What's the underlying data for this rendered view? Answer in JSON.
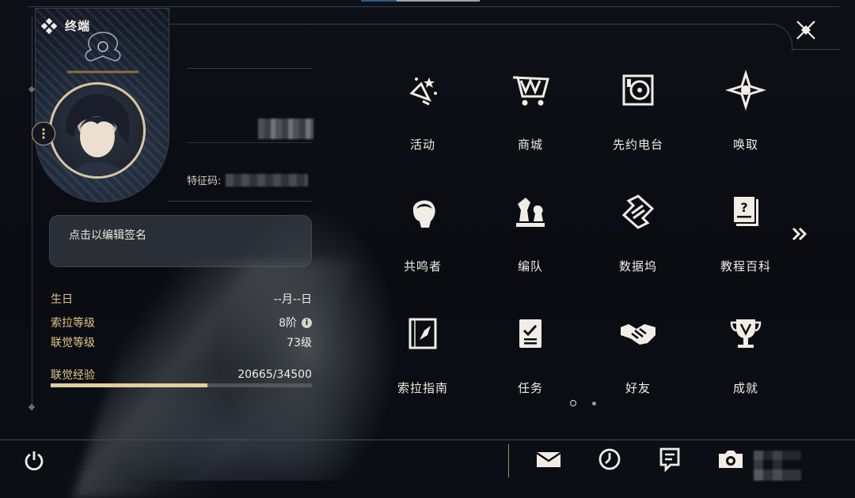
{
  "window": {
    "title": "终端"
  },
  "profile": {
    "uid_label": "特征码:",
    "signature_placeholder": "点击以编辑签名"
  },
  "stats": [
    {
      "label": "生日",
      "value": "--月--日"
    },
    {
      "label": "索拉等级",
      "value": "8阶",
      "info": "i"
    },
    {
      "label": "联觉等级",
      "value": "73级"
    },
    {
      "label": "联觉经验",
      "value": "20665/34500",
      "progress": 0.599
    }
  ],
  "menu": [
    {
      "label": "活动",
      "icon": "activity-icon"
    },
    {
      "label": "商城",
      "icon": "shop-cart-icon"
    },
    {
      "label": "先约电台",
      "icon": "radio-icon"
    },
    {
      "label": "唤取",
      "icon": "convene-star-icon"
    },
    {
      "label": "共鸣者",
      "icon": "resonator-icon"
    },
    {
      "label": "编队",
      "icon": "team-chess-icon"
    },
    {
      "label": "数据坞",
      "icon": "data-bank-icon"
    },
    {
      "label": "教程百科",
      "icon": "tutorial-book-icon"
    },
    {
      "label": "索拉指南",
      "icon": "compass-guide-icon"
    },
    {
      "label": "任务",
      "icon": "quest-checklist-icon"
    },
    {
      "label": "好友",
      "icon": "handshake-icon"
    },
    {
      "label": "成就",
      "icon": "trophy-icon"
    }
  ],
  "pager": {
    "pages": 2,
    "current": 1
  },
  "bottom_bar": {
    "icons": [
      "power-icon",
      "mail-icon",
      "clock-icon",
      "notice-icon",
      "camera-icon"
    ]
  },
  "colors": {
    "accent_gold": "#e3c787",
    "text": "#f1ede4",
    "bg": "#0b0d13"
  }
}
